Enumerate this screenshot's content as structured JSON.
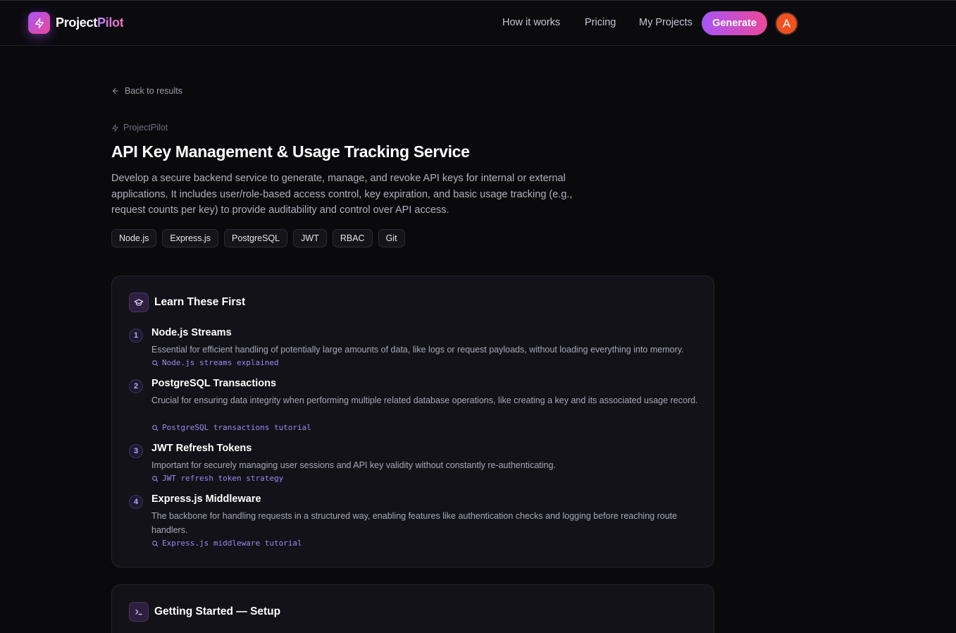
{
  "header": {
    "brand_part1": "Project",
    "brand_part2": "Pilot",
    "nav": [
      {
        "label": "How it works"
      },
      {
        "label": "Pricing"
      },
      {
        "label": "My Projects"
      }
    ],
    "generate_label": "Generate",
    "avatar_initial": "A"
  },
  "back_label": "Back to results",
  "breadcrumb": "ProjectPilot",
  "project": {
    "title": "API Key Management & Usage Tracking Service",
    "description": "Develop a secure backend service to generate, manage, and revoke API keys for internal or external applications. It includes user/role-based access control, key expiration, and basic usage tracking (e.g., request counts per key) to provide auditability and control over API access.",
    "tags": [
      "Node.js",
      "Express.js",
      "PostgreSQL",
      "JWT",
      "RBAC",
      "Git"
    ]
  },
  "learn": {
    "title": "Learn These First",
    "items": [
      {
        "num": "1",
        "title": "Node.js Streams",
        "desc": "Essential for efficient handling of potentially large amounts of data, like logs or request payloads, without loading everything into memory.",
        "search": "Node.js streams explained"
      },
      {
        "num": "2",
        "title": "PostgreSQL Transactions",
        "desc": "Crucial for ensuring data integrity when performing multiple related database operations, like creating a key and its associated usage record.",
        "search": "PostgreSQL transactions tutorial"
      },
      {
        "num": "3",
        "title": "JWT Refresh Tokens",
        "desc": "Important for securely managing user sessions and API key validity without constantly re-authenticating.",
        "search": "JWT refresh token strategy"
      },
      {
        "num": "4",
        "title": "Express.js Middleware",
        "desc": "The backbone for handling requests in a structured way, enabling features like authentication checks and logging before reaching route handlers.",
        "search": "Express.js middleware tutorial"
      }
    ]
  },
  "setup": {
    "title": "Getting Started — Setup"
  },
  "colors": {
    "accent_from": "#a855f7",
    "accent_to": "#ec4899",
    "avatar": "#f0511f",
    "background": "#0a0a0c"
  }
}
